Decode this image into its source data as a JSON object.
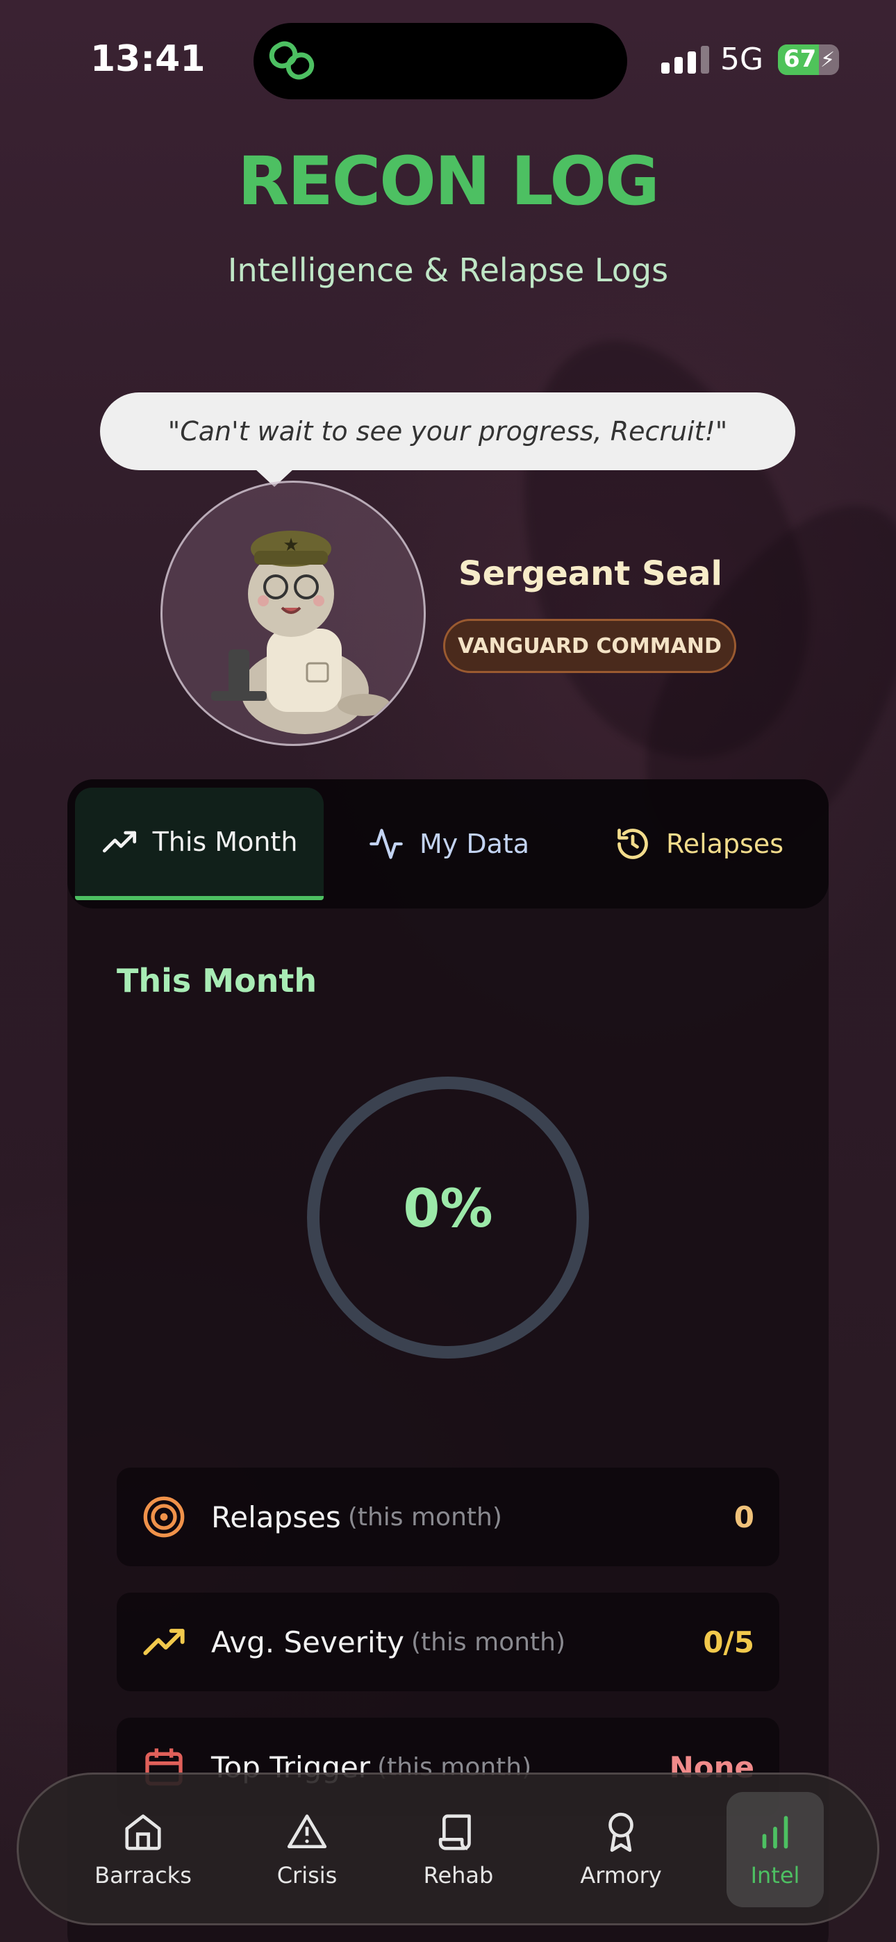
{
  "status_bar": {
    "time": "13:41",
    "network": "5G",
    "battery": "67",
    "battery_level": 0.67
  },
  "header": {
    "title": "RECON LOG",
    "subtitle": "Intelligence & Relapse Logs"
  },
  "mascot": {
    "quote": "\"Can't wait to see your progress, Recruit!\"",
    "name": "Sergeant Seal",
    "badge": "VANGUARD COMMAND"
  },
  "tabs": [
    {
      "label": "This Month",
      "icon": "trending-up-icon",
      "active": true
    },
    {
      "label": "My Data",
      "icon": "activity-icon",
      "active": false
    },
    {
      "label": "Relapses",
      "icon": "history-icon",
      "active": false
    }
  ],
  "section": {
    "title": "This Month",
    "progress_label": "0%",
    "progress_value": 0
  },
  "stats": [
    {
      "label": "Relapses",
      "sub": "(this month)",
      "value": "0",
      "icon": "target-icon",
      "color": "#f0c27a"
    },
    {
      "label": "Avg. Severity",
      "sub": "(this month)",
      "value": "0/5",
      "icon": "trending-up-icon",
      "color": "#f2c94c"
    },
    {
      "label": "Top Trigger",
      "sub": "(this month)",
      "value": "None",
      "icon": "calendar-icon",
      "color": "#f08a8a"
    }
  ],
  "nav": [
    {
      "label": "Barracks",
      "icon": "home-icon"
    },
    {
      "label": "Crisis",
      "icon": "warning-icon"
    },
    {
      "label": "Rehab",
      "icon": "scroll-icon"
    },
    {
      "label": "Armory",
      "icon": "award-icon"
    },
    {
      "label": "Intel",
      "icon": "bar-chart-icon",
      "active": true
    }
  ],
  "colors": {
    "accent": "#4dc062",
    "background": "#2a1a25"
  }
}
